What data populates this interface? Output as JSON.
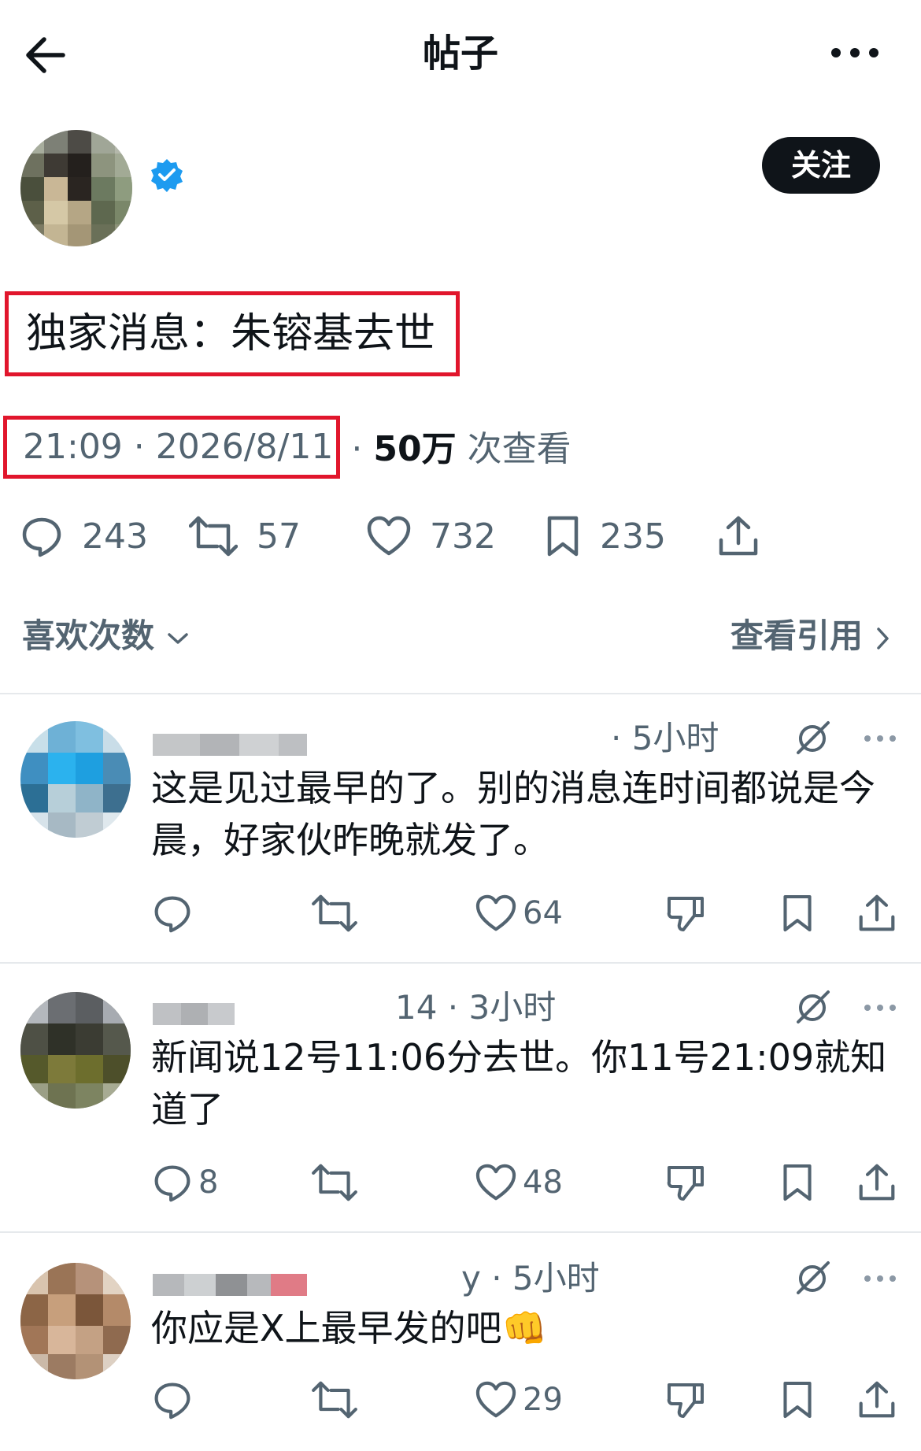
{
  "header": {
    "title": "帖子",
    "back_icon": "arrow-left-icon",
    "more_icon": "more-horizontal-icon"
  },
  "author": {
    "verified_icon": "verified-badge-icon",
    "verified_color": "#1d9bf0",
    "follow_label": "关注"
  },
  "post": {
    "text": "独家消息：朱镕基去世",
    "time": "21:09 · 2026/8/11",
    "separator": " · ",
    "views_count": "50万",
    "views_label": " 次查看",
    "highlight_color": "#e1162c"
  },
  "actions": {
    "replies": "243",
    "reposts": "57",
    "likes": "732",
    "bookmarks": "235"
  },
  "subheader": {
    "likes_link": "喜欢次数",
    "quotes_link": "查看引用"
  },
  "replies": [
    {
      "handle": "· 5小时",
      "text": "这是见过最早的了。别的消息连时间都说是今晨，好家伙昨晚就发了。",
      "replies": "",
      "likes": "64"
    },
    {
      "handle": "14 · 3小时",
      "text": "新闻说12号11:06分去世。你11号21:09就知道了",
      "replies": "8",
      "likes": "48"
    },
    {
      "handle": "y · 5小时",
      "text": "你应是X上最早发的吧👊",
      "replies": "",
      "likes": "29"
    }
  ],
  "colors": {
    "text": "#0f1419",
    "secondary": "#536471",
    "divider": "#e6e9ec"
  }
}
